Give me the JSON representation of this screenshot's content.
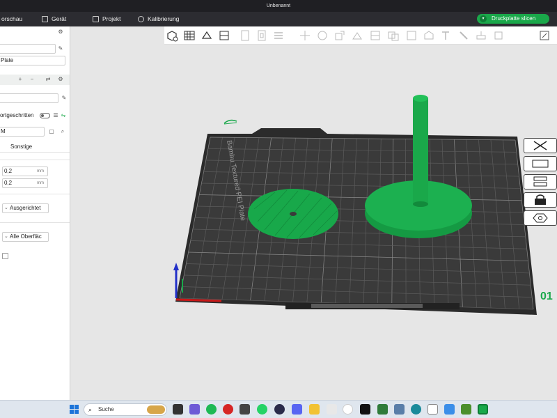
{
  "window": {
    "title": "Unbenannt"
  },
  "nav": {
    "items": [
      {
        "label": "orschau",
        "icon": "preview-icon"
      },
      {
        "label": "Gerät",
        "icon": "device-icon"
      },
      {
        "label": "Projekt",
        "icon": "project-icon"
      },
      {
        "label": "Kalibrierung",
        "icon": "calibration-icon"
      }
    ],
    "slice_label": "Druckplatte slicen",
    "accent": "#1aa84a"
  },
  "left_panel": {
    "plate_type": "Plate",
    "advanced_label": "ortgeschritten",
    "search_value": "M",
    "tab_other": "Sonstige",
    "layer_height_1": "0,2",
    "layer_height_2": "0,2",
    "unit": "mm",
    "seam_option": "Ausgerichtet",
    "surface_option": "Alle Oberfläc"
  },
  "viewport": {
    "bed_label": "Bambu Textured PEI Plate",
    "bed_color": "#2b2b2b",
    "model_color": "#18a84a",
    "plate_number": "01"
  },
  "taskbar": {
    "search_placeholder": "Suche"
  }
}
